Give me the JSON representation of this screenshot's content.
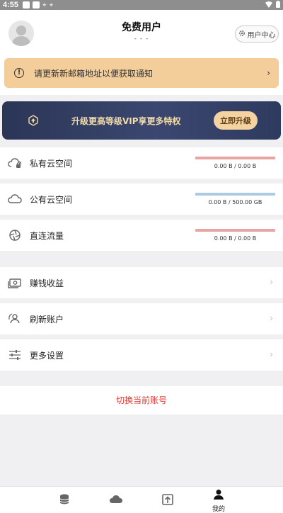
{
  "status_bar": {
    "time": "4:55"
  },
  "header": {
    "user_name": "免费用户",
    "user_sub": "- - -",
    "user_center_label": "用户中心"
  },
  "notice": {
    "text": "请更新新邮箱地址以便获取通知"
  },
  "vip": {
    "text": "升级更高等级VIP享更多特权",
    "button": "立即升级"
  },
  "storage": [
    {
      "label": "私有云空间",
      "usage": "0.00 B / 0.00 B",
      "bar_color": "#e8a3a3"
    },
    {
      "label": "公有云空间",
      "usage": "0.00 B / 500.00 GB",
      "bar_color": "#a9cce3"
    },
    {
      "label": "直连流量",
      "usage": "0.00 B / 0.00 B",
      "bar_color": "#e8a3a3"
    }
  ],
  "menu": [
    {
      "label": "赚钱收益",
      "icon": "money-icon"
    },
    {
      "label": "刷新账户",
      "icon": "refresh-account-icon"
    },
    {
      "label": "更多设置",
      "icon": "sliders-icon"
    }
  ],
  "switch_account": "切换当前账号",
  "bottom_nav": {
    "active_label": "我的",
    "items": [
      "database-icon",
      "cloud-icon",
      "upload-icon",
      "user-icon"
    ]
  },
  "colors": {
    "accent_red": "#e53935",
    "vip_gold": "#f4d3a0",
    "notice_bg": "#f3cd9a"
  }
}
